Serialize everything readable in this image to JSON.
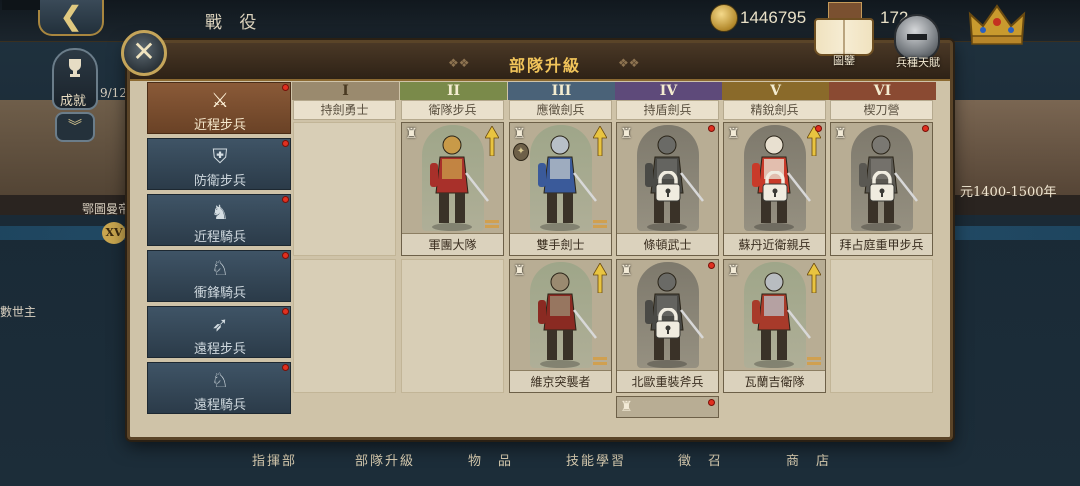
{
  "topbar": {
    "screen_title": "戰 役",
    "gold": "1446795",
    "resource2": "172"
  },
  "background": {
    "achievement_label": "成就",
    "left_page": "9/12",
    "left_stage_label": "鄂圖曼帝",
    "stage_badge": "XV",
    "right_stage_label": "元1400-1500年",
    "ruler_label": "數世主"
  },
  "bottom_nav": [
    "指揮部",
    "部隊升級",
    "物　品",
    "技能學習",
    "徵　召",
    "商　店"
  ],
  "panel": {
    "title": "部隊升級",
    "close_glyph": "✕",
    "codex_label": "圖鑒",
    "talent_label": "兵種天賦"
  },
  "sidebar": {
    "items": [
      {
        "label": "近程步兵",
        "icon": "crossed-swords-icon",
        "glyph": "⚔",
        "active": true
      },
      {
        "label": "防衛步兵",
        "icon": "shield-icon",
        "glyph": "⛨",
        "active": false
      },
      {
        "label": "近程騎兵",
        "icon": "horse-icon",
        "glyph": "♞",
        "active": false
      },
      {
        "label": "衝鋒騎兵",
        "icon": "lance-horse-icon",
        "glyph": "♘",
        "active": false
      },
      {
        "label": "遠程步兵",
        "icon": "bow-icon",
        "glyph": "➶",
        "active": false
      },
      {
        "label": "遠程騎兵",
        "icon": "horse-archer-icon",
        "glyph": "♘",
        "active": false
      }
    ]
  },
  "tiers": [
    {
      "numeral": "I",
      "color": "#9a8a6e",
      "text": "#4a3a22",
      "prev_unit": "持劍勇士"
    },
    {
      "numeral": "II",
      "color": "#7a8a4a",
      "text": "#f4ecd0",
      "prev_unit": "衛隊步兵"
    },
    {
      "numeral": "III",
      "color": "#4a6278",
      "text": "#f4ecd0",
      "prev_unit": "應徵劍兵"
    },
    {
      "numeral": "IV",
      "color": "#5e4a7a",
      "text": "#f4ecd0",
      "prev_unit": "持盾劍兵"
    },
    {
      "numeral": "V",
      "color": "#8a6a2a",
      "text": "#f4ecd0",
      "prev_unit": "精銳劍兵"
    },
    {
      "numeral": "VI",
      "color": "#8a4a32",
      "text": "#f4ecd0",
      "prev_unit": "楔刀營"
    }
  ],
  "units": [
    {
      "name": "軍團大隊",
      "tier": 2,
      "row": 1,
      "locked": false,
      "upgradable": true,
      "colors": {
        "body": "#a8302a",
        "armor": "#c89a48"
      }
    },
    {
      "name": "雙手劍士",
      "tier": 3,
      "row": 1,
      "locked": false,
      "upgradable": true,
      "colors": {
        "body": "#3a5a9a",
        "armor": "#b8c0c8"
      }
    },
    {
      "name": "條頓武士",
      "tier": 4,
      "row": 1,
      "locked": true,
      "upgradable": false,
      "colors": {
        "body": "#4a4a46",
        "armor": "#6a6a66"
      }
    },
    {
      "name": "蘇丹近衛親兵",
      "tier": 5,
      "row": 1,
      "locked": true,
      "upgradable": true,
      "colors": {
        "body": "#c83a2a",
        "armor": "#e8e0d0"
      }
    },
    {
      "name": "拜占庭重甲步兵",
      "tier": 6,
      "row": 1,
      "locked": true,
      "upgradable": false,
      "colors": {
        "body": "#5a5852",
        "armor": "#7a7872"
      }
    },
    {
      "name": "維京突襲者",
      "tier": 3,
      "row": 2,
      "locked": false,
      "upgradable": true,
      "colors": {
        "body": "#8a2a22",
        "armor": "#9a8a70"
      }
    },
    {
      "name": "北歐重裝斧兵",
      "tier": 4,
      "row": 2,
      "locked": true,
      "upgradable": false,
      "colors": {
        "body": "#4a4a46",
        "armor": "#6a6a66"
      }
    },
    {
      "name": "瓦蘭吉衛隊",
      "tier": 5,
      "row": 2,
      "locked": false,
      "upgradable": true,
      "colors": {
        "body": "#a83a2a",
        "armor": "#b8bcc0"
      }
    }
  ],
  "colors": {
    "title_gold": "#f1c45a",
    "upgrade_arrow": "#e8c440",
    "notification_red": "#e03020"
  }
}
